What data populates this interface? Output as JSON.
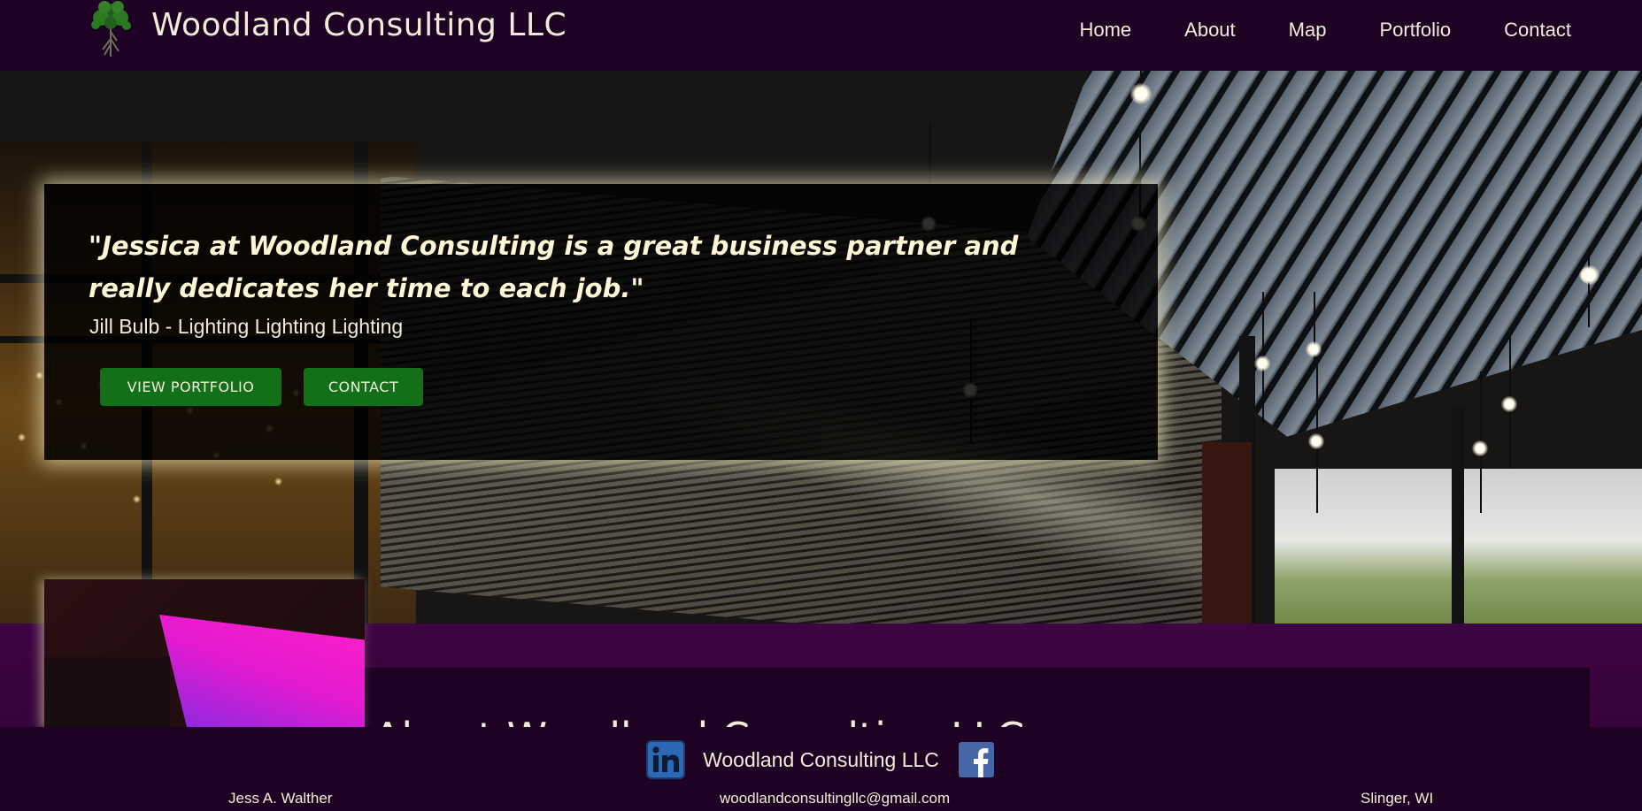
{
  "header": {
    "brand": "Woodland Consulting LLC",
    "logo_icon": "tree-icon",
    "nav": [
      "Home",
      "About",
      "Map",
      "Portfolio",
      "Contact"
    ]
  },
  "hero": {
    "quote": "\"Jessica at Woodland Consulting is a great business partner and really dedicates her time to each job.\"",
    "author": "Jill Bulb - Lighting Lighting Lighting",
    "buttons": {
      "portfolio": "VIEW PORTFOLIO",
      "contact": "CONTACT"
    }
  },
  "about": {
    "title": "About Woodland Consulting LLC"
  },
  "footer": {
    "name": "Woodland Consulting LLC",
    "owner": "Jess A. Walther",
    "email": "woodlandconsultingllc@gmail.com",
    "location": "Slinger, WI",
    "social": [
      "linkedin-icon",
      "facebook-icon"
    ]
  },
  "colors": {
    "header_bg": "#1e0224",
    "section_bg": "#3e0543",
    "accent_green": "#127118",
    "text_cream": "#f1ecd9",
    "quote_glow": "#f0e8be"
  }
}
